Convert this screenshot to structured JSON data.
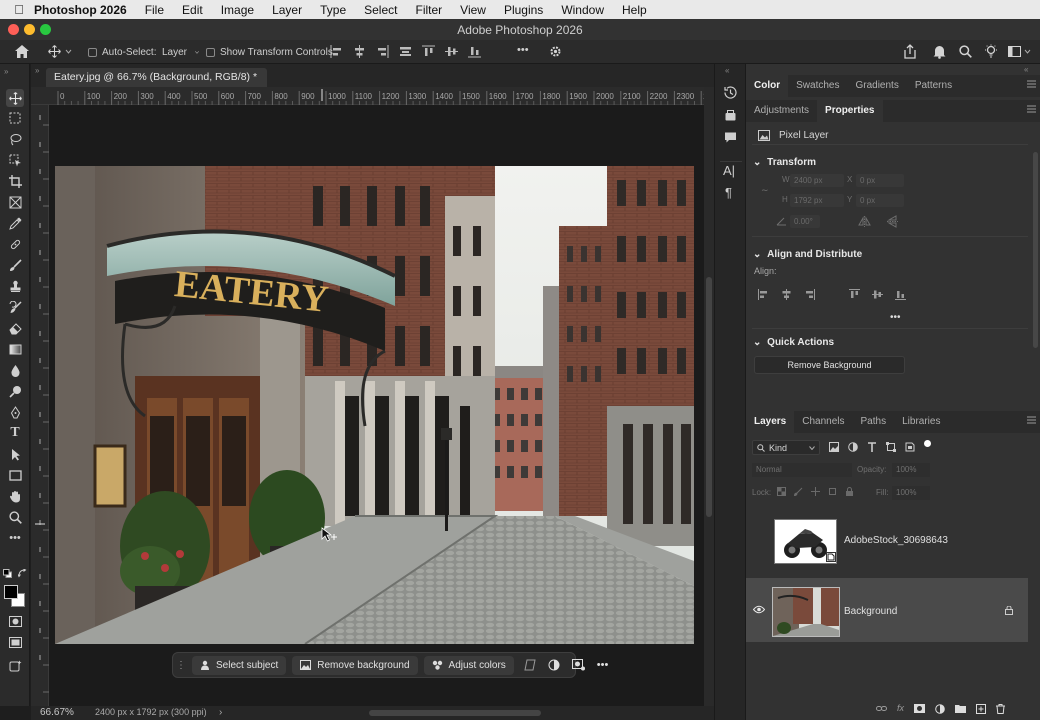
{
  "menubar": {
    "app": "Photoshop 2026",
    "items": [
      "File",
      "Edit",
      "Image",
      "Layer",
      "Type",
      "Select",
      "Filter",
      "View",
      "Plugins",
      "Window",
      "Help"
    ]
  },
  "window": {
    "title": "Adobe Photoshop 2026"
  },
  "options": {
    "auto_select_label": "Auto-Select:",
    "auto_select_value": "Layer",
    "show_transform_label": "Show Transform Controls",
    "more": "•••"
  },
  "document": {
    "tab_title": "Eatery.jpg @ 66.7% (Background, RGB/8) *",
    "ruler_ticks": [
      "0",
      "100",
      "200",
      "300",
      "400",
      "500",
      "600",
      "700",
      "800",
      "900",
      "1000",
      "1100",
      "1200",
      "1300",
      "1400",
      "1500",
      "1600",
      "1700",
      "1800",
      "1900",
      "2000",
      "2100",
      "2200",
      "2300",
      "2"
    ]
  },
  "image": {
    "sign_text": "EATERY",
    "colors": {
      "brick": "#7a4a3b",
      "sky": "#e8ebe8",
      "stone": "#8b8d8a",
      "sign_gold": "#d9b05c"
    }
  },
  "taskbar": {
    "select_subject": "Select subject",
    "remove_background": "Remove background",
    "adjust_colors": "Adjust colors"
  },
  "status": {
    "zoom": "66.67%",
    "doc_info": "2400 px x 1792 px (300 ppi)"
  },
  "panels": {
    "top_tabs": [
      "Color",
      "Swatches",
      "Gradients",
      "Patterns"
    ],
    "second_tabs": [
      "Adjustments",
      "Properties"
    ],
    "properties": {
      "layer_kind": "Pixel Layer",
      "transform_title": "Transform",
      "w_label": "W",
      "w_value": "2400 px",
      "h_label": "H",
      "h_value": "1792 px",
      "x_label": "X",
      "x_value": "0 px",
      "y_label": "Y",
      "y_value": "0 px",
      "angle_value": "0.00°",
      "align_title": "Align and Distribute",
      "align_label": "Align:",
      "more": "•••",
      "quick_actions_title": "Quick Actions",
      "remove_background_button": "Remove Background"
    },
    "layers_tabs": [
      "Layers",
      "Channels",
      "Paths",
      "Libraries"
    ],
    "layers": {
      "filter_kind": "Kind",
      "blend_mode": "Normal",
      "opacity_label": "Opacity:",
      "opacity_value": "100%",
      "lock_label": "Lock:",
      "fill_label": "Fill:",
      "fill_value": "100%",
      "items": [
        {
          "name": "AdobeStock_30698643",
          "visible": false
        },
        {
          "name": "Background",
          "visible": true
        }
      ]
    }
  },
  "colors": {
    "accent": "#2b6ff5",
    "panel": "#323232",
    "dark": "#1e1e1e"
  }
}
